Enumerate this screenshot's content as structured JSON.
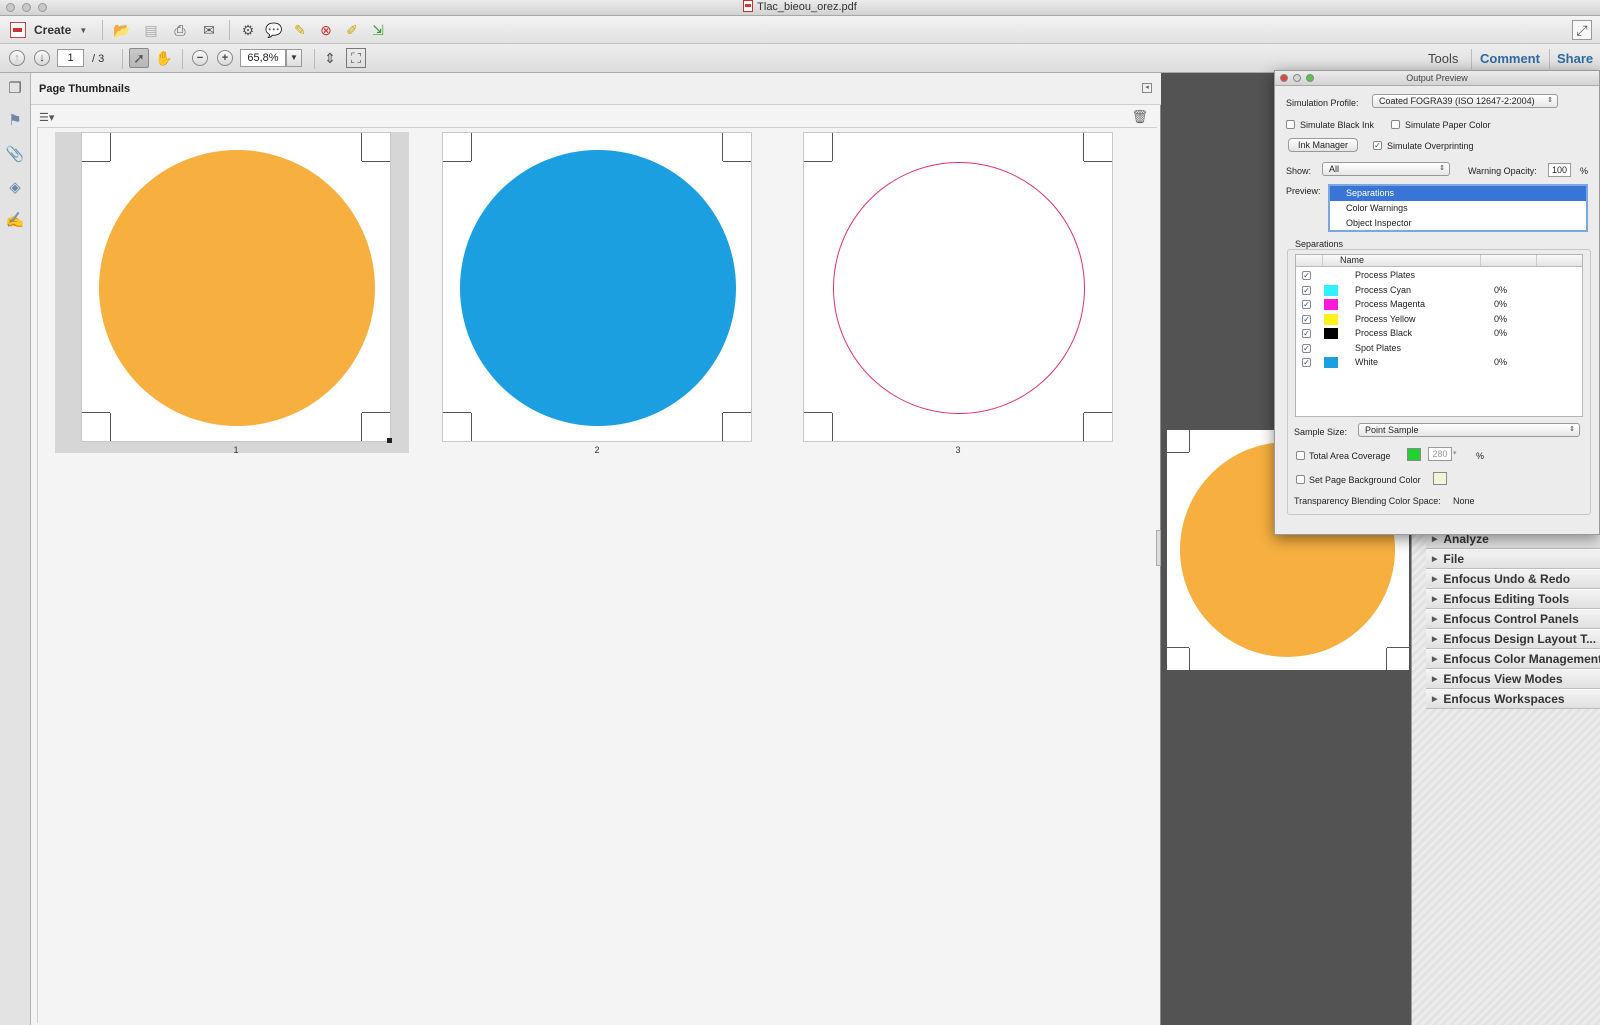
{
  "window": {
    "title": "Tlac_bieou_orez.pdf"
  },
  "toolbar": {
    "create_label": "Create",
    "page_current": "1",
    "page_total": "/  3",
    "zoom": "65,8%",
    "tools_label": "Tools",
    "comment_label": "Comment",
    "share_label": "Share"
  },
  "thumbnails": {
    "title": "Page Thumbnails",
    "pages": [
      {
        "num": "1",
        "fill": "#f7b040",
        "kind": "filled"
      },
      {
        "num": "2",
        "fill": "#1b9fe0",
        "kind": "filled"
      },
      {
        "num": "3",
        "stroke": "#e0307a",
        "kind": "outline"
      }
    ]
  },
  "document": {
    "circle_color": "#f7b040"
  },
  "tool_panels": [
    "Analyze",
    "File",
    "Enfocus Undo & Redo",
    "Enfocus Editing Tools",
    "Enfocus Control Panels",
    "Enfocus Design Layout T...",
    "Enfocus Color Management",
    "Enfocus View Modes",
    "Enfocus Workspaces"
  ],
  "output_preview": {
    "title": "Output Preview",
    "simulation_profile_label": "Simulation Profile:",
    "simulation_profile_value": "Coated FOGRA39 (ISO 12647-2:2004)",
    "simulate_black_ink": "Simulate Black Ink",
    "simulate_paper_color": "Simulate Paper Color",
    "ink_manager": "Ink Manager",
    "simulate_overprinting": "Simulate Overprinting",
    "show_label": "Show:",
    "show_value": "All",
    "warning_opacity_label": "Warning Opacity:",
    "warning_opacity_value": "100",
    "percent": "%",
    "preview_label": "Preview:",
    "preview_options": [
      "Separations",
      "Color Warnings",
      "Object Inspector"
    ],
    "separations_label": "Separations",
    "table_header_name": "Name",
    "separations": [
      {
        "name": "Process Plates",
        "swatch": "",
        "value": ""
      },
      {
        "name": "Process Cyan",
        "swatch": "#2ef2ff",
        "value": "0%"
      },
      {
        "name": "Process Magenta",
        "swatch": "#ff1ad6",
        "value": "0%"
      },
      {
        "name": "Process Yellow",
        "swatch": "#fff21a",
        "value": "0%"
      },
      {
        "name": "Process Black",
        "swatch": "#000000",
        "value": "0%"
      },
      {
        "name": "Spot Plates",
        "swatch": "",
        "value": ""
      },
      {
        "name": "White",
        "swatch": "#1b9fe0",
        "value": "0%"
      }
    ],
    "sample_size_label": "Sample Size:",
    "sample_size_value": "Point Sample",
    "total_area_coverage": "Total Area Coverage",
    "tac_value": "280",
    "tac_color": "#22d032",
    "set_page_background": "Set Page Background Color",
    "page_bg_color": "#f5f2dd",
    "tbcs_label": "Transparency Blending Color Space:",
    "tbcs_value": "None"
  }
}
